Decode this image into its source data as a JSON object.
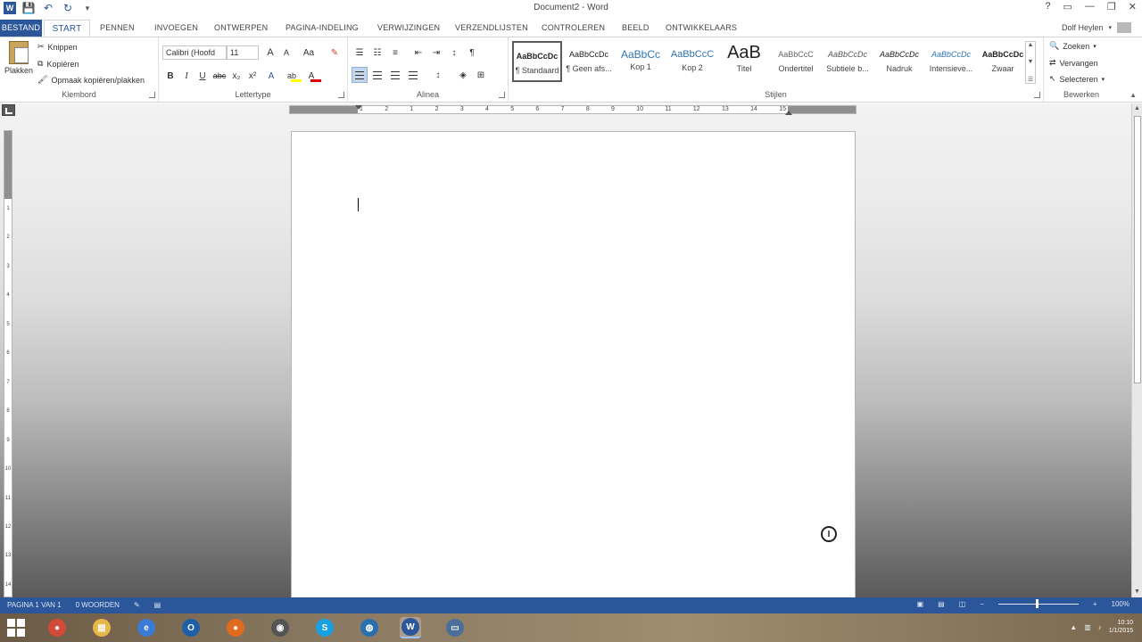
{
  "window": {
    "title": "Document2 - Word",
    "controls": [
      "?",
      "▭",
      "—",
      "❐",
      "✕"
    ]
  },
  "qat": {
    "save_label": "💾",
    "undo_label": "↶",
    "redo_label": "↻",
    "customize_label": "▾"
  },
  "tabs": {
    "file": "BESTAND",
    "items": [
      "START",
      "PENNEN",
      "INVOEGEN",
      "ONTWERPEN",
      "PAGINA-INDELING",
      "VERWIJZINGEN",
      "VERZENDLIJSTEN",
      "CONTROLEREN",
      "BEELD",
      "ONTWIKKELAARS"
    ],
    "user": "Dolf Heylen"
  },
  "ribbon": {
    "clipboard": {
      "label": "Klembord",
      "paste": "Plakken",
      "cut": "Knippen",
      "copy": "Kopiëren",
      "format_painter": "Opmaak kopiëren/plakken"
    },
    "font": {
      "label": "Lettertype",
      "font_name": "Calibri (Hoofd",
      "font_size": "11",
      "grow": "A",
      "shrink": "A",
      "case": "Aa",
      "bold": "B",
      "italic": "I",
      "underline": "U",
      "strike": "abc",
      "subscript": "x₂",
      "superscript": "x²",
      "effects": "A",
      "highlight": "ab",
      "font_color": "A",
      "highlight_color": "#ffff00",
      "font_color_value": "#dd0000"
    },
    "paragraph": {
      "label": "Alinea",
      "pilcrow": "¶",
      "sort": "↕"
    },
    "styles": {
      "label": "Stijlen",
      "items": [
        {
          "preview": "AaBbCcDc",
          "name": "¶ Standaard"
        },
        {
          "preview": "AaBbCcDc",
          "name": "¶ Geen afs..."
        },
        {
          "preview": "AaBbCc",
          "name": "Kop 1"
        },
        {
          "preview": "AaBbCcC",
          "name": "Kop 2"
        },
        {
          "preview": "AaB",
          "name": "Titel"
        },
        {
          "preview": "AaBbCcC",
          "name": "Ondertitel"
        },
        {
          "preview": "AaBbCcDc",
          "name": "Subtiele b..."
        },
        {
          "preview": "AaBbCcDc",
          "name": "Nadruk"
        },
        {
          "preview": "AaBbCcDc",
          "name": "Intensieve..."
        },
        {
          "preview": "AaBbCcDc",
          "name": "Zwaar"
        }
      ]
    },
    "editing": {
      "label": "Bewerken",
      "find": "Zoeken",
      "replace": "Vervangen",
      "select": "Selecteren"
    }
  },
  "ruler": {
    "h_ticks": [
      "1",
      "2",
      "1",
      "2",
      "3",
      "4",
      "5",
      "6",
      "7",
      "8",
      "9",
      "10",
      "11",
      "12",
      "13",
      "14",
      "15"
    ],
    "v_ticks": [
      "1",
      "2",
      "3",
      "4",
      "5",
      "6",
      "7",
      "8",
      "9",
      "10",
      "11",
      "12",
      "13",
      "14"
    ]
  },
  "statusbar": {
    "page": "PAGINA 1 VAN 1",
    "words": "0 WOORDEN",
    "zoom_minus": "−",
    "zoom_plus": "+",
    "zoom": "100%"
  },
  "taskbar": {
    "apps": [
      {
        "name": "chrome",
        "glyph": "●",
        "color": "#d24b3a"
      },
      {
        "name": "explorer",
        "glyph": "▤",
        "color": "#e6b84a"
      },
      {
        "name": "ie",
        "glyph": "e",
        "color": "#3a7bd5"
      },
      {
        "name": "outlook",
        "glyph": "O",
        "color": "#1f5fa8"
      },
      {
        "name": "firefox",
        "glyph": "●",
        "color": "#e06b1f"
      },
      {
        "name": "app",
        "glyph": "◉",
        "color": "#555"
      },
      {
        "name": "skype",
        "glyph": "S",
        "color": "#1aa0e0"
      },
      {
        "name": "globe",
        "glyph": "◍",
        "color": "#2a6fb0"
      },
      {
        "name": "word",
        "glyph": "W",
        "color": "#2b579a"
      },
      {
        "name": "screen",
        "glyph": "▭",
        "color": "#4a6f9a"
      }
    ],
    "time": "10:10",
    "date": "1/1/2015"
  }
}
